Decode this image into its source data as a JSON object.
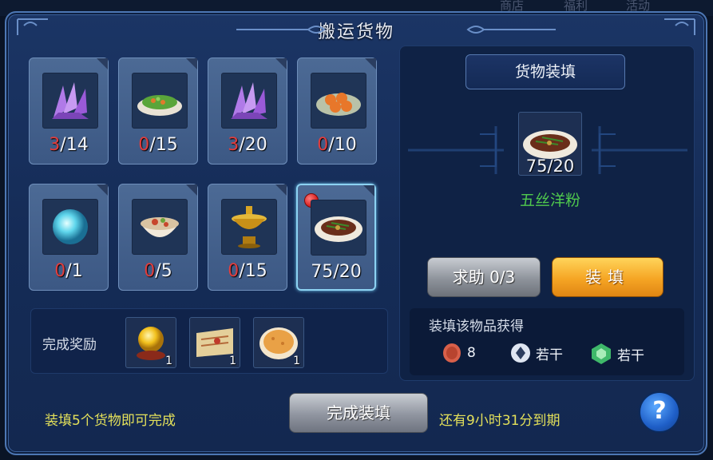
{
  "background": {
    "labels": [
      "商店",
      "福利",
      "活动"
    ]
  },
  "window": {
    "title": "搬运货物"
  },
  "slots": [
    {
      "icon": "purple-crystal-icon",
      "current": "3",
      "total": "/14"
    },
    {
      "icon": "vegetable-dish-icon",
      "current": "0",
      "total": "/15"
    },
    {
      "icon": "purple-crystal-icon",
      "current": "3",
      "total": "/20"
    },
    {
      "icon": "pastry-plate-icon",
      "current": "0",
      "total": "/10"
    },
    {
      "icon": "blue-orb-icon",
      "current": "0",
      "total": "/1"
    },
    {
      "icon": "noodle-bowl-icon",
      "current": "0",
      "total": "/5"
    },
    {
      "icon": "hotpot-icon",
      "current": "0",
      "total": "/15"
    },
    {
      "icon": "stir-fry-plate-icon",
      "current": "",
      "total": "75/20"
    }
  ],
  "reward": {
    "label": "完成奖励",
    "items": [
      {
        "icon": "golden-orb-icon",
        "qty": "1"
      },
      {
        "icon": "scroll-map-icon",
        "qty": "1"
      },
      {
        "icon": "pancake-icon",
        "qty": "1"
      }
    ]
  },
  "fill_panel": {
    "header": "货物装填",
    "target_icon": "stir-fry-plate-icon",
    "target_count": "75/20",
    "target_name": "五丝洋粉",
    "help_button": "求助 0/3",
    "fill_button": "装填",
    "gain_title": "装填该物品获得",
    "gains": [
      {
        "icon": "copper-coin-icon",
        "value": "8"
      },
      {
        "icon": "silver-coin-icon",
        "value": "若干"
      },
      {
        "icon": "green-token-icon",
        "value": "若干"
      }
    ]
  },
  "footer": {
    "left_text": "装填5个货物即可完成",
    "complete_button": "完成装填",
    "right_text": "还有9小时31分到期",
    "help_icon_label": "?"
  },
  "colors": {
    "accent_red": "#e03d3d",
    "name_green": "#4fc84d",
    "notice_yellow": "#e3e05a",
    "fill_orange": "#f5a524"
  }
}
